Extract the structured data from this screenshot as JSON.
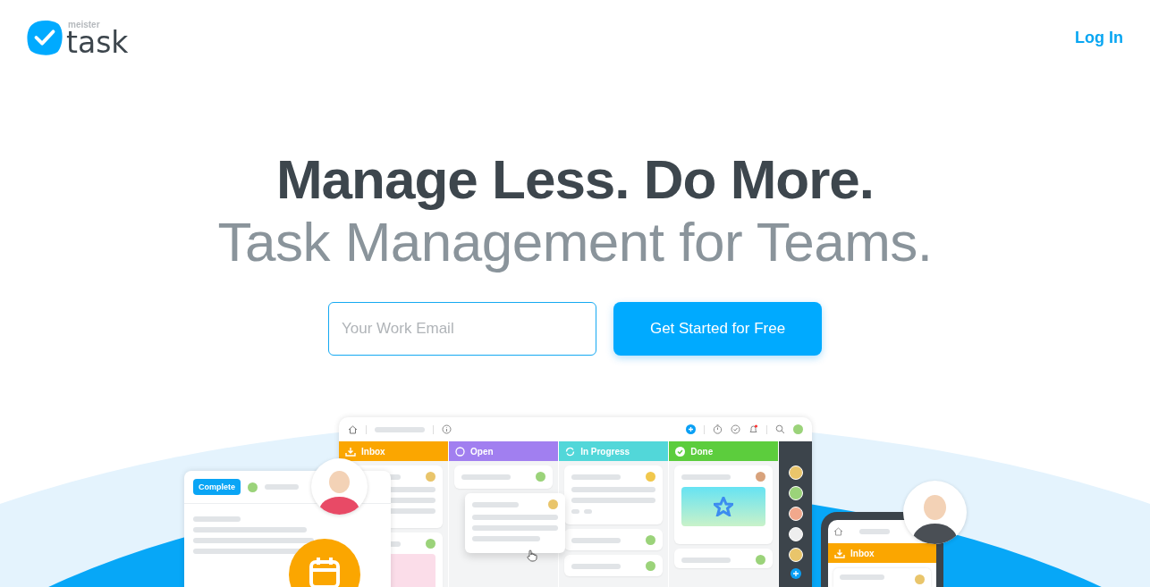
{
  "header": {
    "logo": {
      "prefix": "meister",
      "word": "task"
    },
    "login": "Log In"
  },
  "hero": {
    "title": "Manage Less. Do More.",
    "subtitle": "Task Management for Teams.",
    "email_field": {
      "placeholder": "Your Work Email"
    },
    "cta": "Get Started for Free"
  },
  "illustration": {
    "columns": [
      {
        "title": "Inbox",
        "kind": "inbox",
        "color": "#fba600"
      },
      {
        "title": "Open",
        "kind": "open",
        "color": "#a17ff0"
      },
      {
        "title": "In Progress",
        "kind": "progress",
        "color": "#52d7d9"
      },
      {
        "title": "Done",
        "kind": "done",
        "color": "#5ccd3d"
      }
    ],
    "task_panel": {
      "button": "Complete"
    },
    "phone": {
      "column": {
        "title": "Inbox",
        "kind": "inbox",
        "color": "#fba600"
      }
    }
  }
}
